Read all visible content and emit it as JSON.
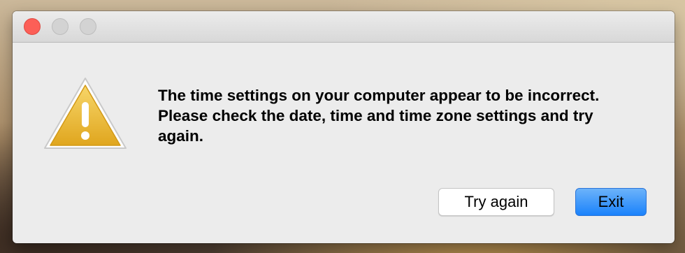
{
  "window": {
    "controls": [
      "close-icon",
      "minimize-icon",
      "maximize-icon"
    ]
  },
  "dialog": {
    "icon": "warning-icon",
    "message": "The time settings on your computer appear to be incorrect. Please check the date, time and time zone settings and try again."
  },
  "buttons": {
    "try_again_label": "Try again",
    "exit_label": "Exit"
  },
  "colors": {
    "close": "#fc5f57",
    "default_button": "#1a82fb",
    "warning": "#e8b82c"
  }
}
